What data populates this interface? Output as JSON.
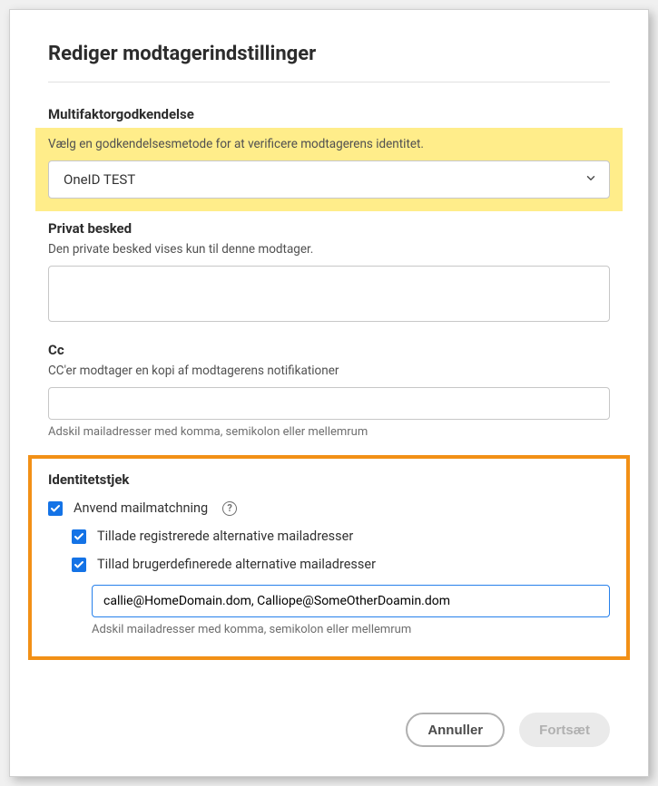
{
  "dialog": {
    "title": "Rediger modtagerindstillinger"
  },
  "mfa": {
    "heading": "Multifaktorgodkendelse",
    "helper": "Vælg en godkendelsesmetode for at verificere modtagerens identitet.",
    "selected": "OneID TEST"
  },
  "privateMessage": {
    "heading": "Privat besked",
    "helper": "Den private besked vises kun til denne modtager.",
    "value": ""
  },
  "cc": {
    "heading": "Cc",
    "helper": "CC'er modtager en kopi af modtagerens notifikationer",
    "value": "",
    "hint": "Adskil mailadresser med komma, semikolon eller mellemrum"
  },
  "identityCheck": {
    "heading": "Identitetstjek",
    "emailMatching": {
      "label": "Anvend mailmatchning",
      "checked": true
    },
    "allowRegistered": {
      "label": "Tillade registrerede alternative mailadresser",
      "checked": true
    },
    "allowCustom": {
      "label": "Tillad brugerdefinerede alternative mailadresser",
      "checked": true,
      "value": "callie@HomeDomain.dom, Calliope@SomeOtherDoamin.dom",
      "hint": "Adskil mailadresser med komma, semikolon eller mellemrum"
    }
  },
  "buttons": {
    "cancel": "Annuller",
    "continue": "Fortsæt"
  }
}
